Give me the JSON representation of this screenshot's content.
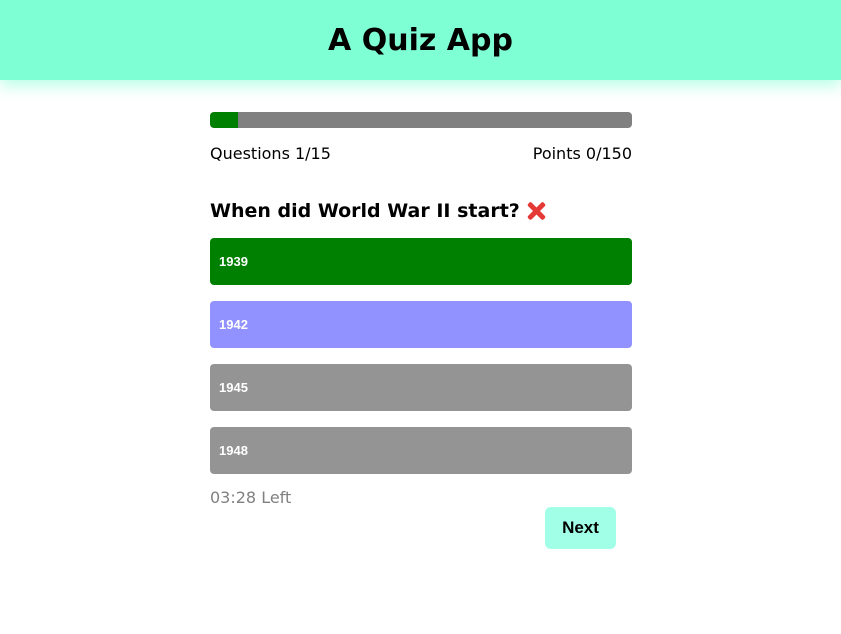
{
  "app": {
    "title": "A Quiz App"
  },
  "progress": {
    "fraction": 0.0667,
    "questions_text": "Questions 1/15",
    "points_text": "Points 0/150"
  },
  "question": {
    "text": "When did World War II start?",
    "status_icon": "cross-mark-icon"
  },
  "options": [
    {
      "label": "1939",
      "state": "correct",
      "color": "#008000"
    },
    {
      "label": "1942",
      "state": "selected-wrong",
      "color": "#9191ff"
    },
    {
      "label": "1945",
      "state": "default",
      "color": "#949494"
    },
    {
      "label": "1948",
      "state": "default",
      "color": "#949494"
    }
  ],
  "timer": {
    "text": "03:28 Left"
  },
  "next_button": {
    "label": "Next",
    "color": "#a0ffe6"
  },
  "colors": {
    "header_bg": "#7fffd4",
    "progress_track": "#808080",
    "progress_fill": "#008000"
  }
}
